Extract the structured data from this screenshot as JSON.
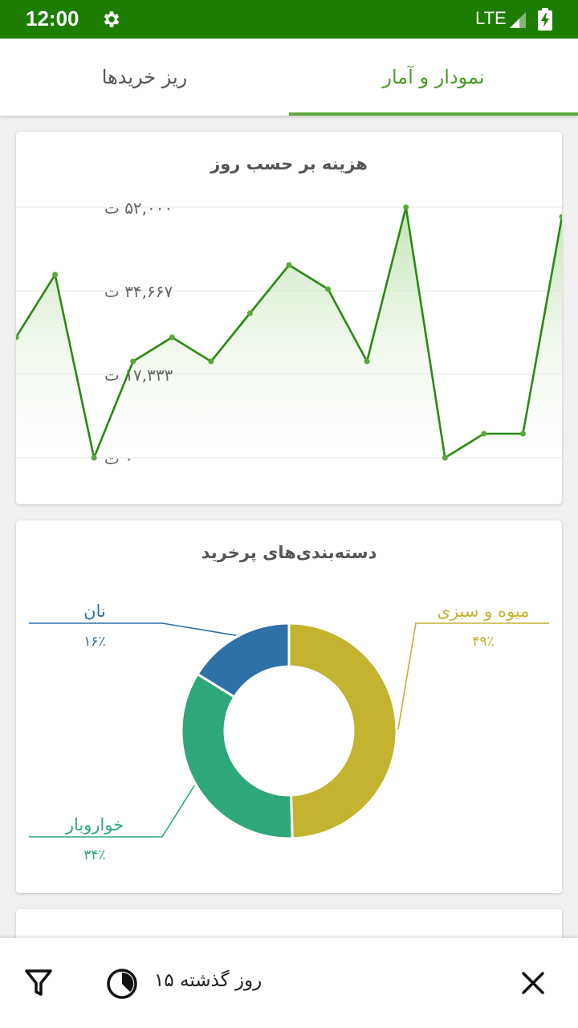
{
  "status_bar": {
    "time": "12:00",
    "network": "LTE"
  },
  "tabs": [
    {
      "label": "نمودار و آمار",
      "active": true
    },
    {
      "label": "ریز خریدها",
      "active": false
    }
  ],
  "colors": {
    "primary_dark": "#1d7d00",
    "accent": "#5aa83a",
    "line": "#2a8a10"
  },
  "line_card": {
    "title": "هزینه بر حسب روز"
  },
  "pie_card": {
    "title": "دسته‌بندی‌های پرخرید"
  },
  "chart_data": [
    {
      "type": "line",
      "title": "هزینه بر حسب روز",
      "xlabel": "",
      "ylabel": "",
      "ylim": [
        0,
        52000
      ],
      "y_tick_labels": [
        "۰ ت",
        "۱۷,۳۳۳ ت",
        "۳۴,۶۶۷ ت",
        "۵۲,۰۰۰ ت"
      ],
      "y_tick_values": [
        0,
        17333,
        34667,
        52000
      ],
      "grid": true,
      "x": [
        1,
        2,
        3,
        4,
        5,
        6,
        7,
        8,
        9,
        10,
        11,
        12,
        13,
        14,
        15
      ],
      "values": [
        25000,
        38000,
        0,
        20000,
        25000,
        20000,
        30000,
        40000,
        35000,
        20000,
        52000,
        0,
        5000,
        5000,
        50000
      ]
    },
    {
      "type": "pie",
      "title": "دسته‌بندی‌های پرخرید",
      "categories": [
        "میوه و سبزی",
        "خواروبار",
        "نان"
      ],
      "values": [
        49,
        34,
        16
      ],
      "value_labels": [
        "۴۹٪",
        "۳۴٪",
        "۱۶٪"
      ],
      "colors": [
        "#c3b330",
        "#2ea87a",
        "#2e70a8"
      ]
    }
  ],
  "bottom_bar": {
    "range_label": "۱۵ روز گذشته",
    "icons": [
      "filter-icon",
      "clock-icon",
      "close-icon"
    ]
  }
}
